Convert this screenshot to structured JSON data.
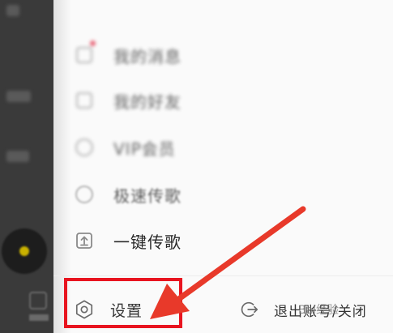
{
  "drawer": {
    "menu": [
      {
        "label": "我的消息",
        "icon": "message-icon",
        "state": "blurred",
        "badge": "red-dot"
      },
      {
        "label": "我的好友",
        "icon": "friends-icon",
        "state": "blurred"
      },
      {
        "label": "VIP会员",
        "icon": "vip-icon",
        "state": "blurred"
      },
      {
        "label": "极速传歌",
        "icon": "wifi-transfer-icon",
        "state": "soft"
      },
      {
        "label": "一键传歌",
        "icon": "upload-icon",
        "state": "normal"
      }
    ],
    "footer": {
      "settings_label": "设置",
      "settings_icon": "hexagon-settings-icon",
      "logout_label": "退出账号/关闭",
      "logout_icon": "logout-icon"
    }
  },
  "annotation": {
    "highlight_color": "#e8141f",
    "arrow_color": "#e8392a",
    "target": "settings"
  },
  "watermark": "Bai经验"
}
